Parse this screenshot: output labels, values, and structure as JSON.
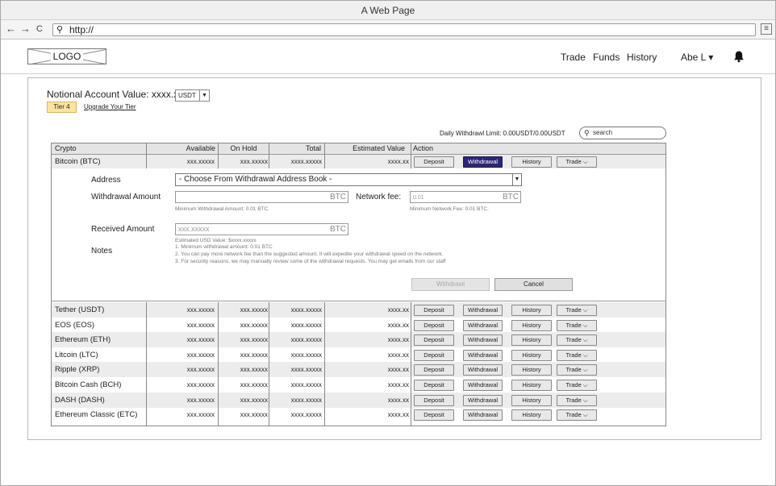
{
  "browser": {
    "title": "A Web Page",
    "url": "http://",
    "back_glyph": "←",
    "forward_glyph": "→",
    "reload_glyph": "C",
    "search_glyph": "⚲",
    "menu_glyph": "≡"
  },
  "header": {
    "logo": "LOGO",
    "nav": [
      "Trade",
      "Funds",
      "History"
    ],
    "user": "Abe L ▾",
    "bell_icon": "bell-icon"
  },
  "account": {
    "notional_label": "Notional Account Value: xxxx.xx",
    "currency": "USDT",
    "currency_arrow": "▼",
    "tier": "Tier 4",
    "upgrade_link": "Upgrade Your Tier",
    "daily_limit": "Daily Withdrawl Limit: 0.00USDT/0.00USDT",
    "search_placeholder": "search"
  },
  "table": {
    "headers": [
      "Crypto",
      "Available",
      "On Hold",
      "Total",
      "Estimated Value",
      "Action"
    ],
    "actions": {
      "deposit": "Deposit",
      "withdrawal": "Withdrawal",
      "history": "History",
      "trade": "Trade ⌵"
    },
    "selected_row": {
      "name": "Bitcoin (BTC)",
      "available": "xxx.xxxxx",
      "on_hold": "xxx.xxxxx",
      "total": "xxxx.xxxxx",
      "est": "xxxx.xx"
    },
    "rows": [
      {
        "name": "Tether (USDT)",
        "available": "xxx.xxxxx",
        "on_hold": "xxx.xxxxx",
        "total": "xxxx.xxxxx",
        "est": "xxxx.xx"
      },
      {
        "name": "EOS (EOS)",
        "available": "xxx.xxxxx",
        "on_hold": "xxx.xxxxx",
        "total": "xxxx.xxxxx",
        "est": "xxxx.xx"
      },
      {
        "name": "Ethereum (ETH)",
        "available": "xxx.xxxxx",
        "on_hold": "xxx.xxxxx",
        "total": "xxxx.xxxxx",
        "est": "xxxx.xx"
      },
      {
        "name": "Litcoin (LTC)",
        "available": "xxx.xxxxx",
        "on_hold": "xxx.xxxxx",
        "total": "xxxx.xxxxx",
        "est": "xxxx.xx"
      },
      {
        "name": "Ripple (XRP)",
        "available": "xxx.xxxxx",
        "on_hold": "xxx.xxxxx",
        "total": "xxxx.xxxxx",
        "est": "xxxx.xx"
      },
      {
        "name": "Bitcoin Cash (BCH)",
        "available": "xxx.xxxxx",
        "on_hold": "xxx.xxxxx",
        "total": "xxxx.xxxxx",
        "est": "xxxx.xx"
      },
      {
        "name": "DASH (DASH)",
        "available": "xxx.xxxxx",
        "on_hold": "xxx.xxxxx",
        "total": "xxxx.xxxxx",
        "est": "xxxx.xx"
      },
      {
        "name": "Ethereum Classic (ETC)",
        "available": "xxx.xxxxx",
        "on_hold": "xxx.xxxxx",
        "total": "xxxx.xxxxx",
        "est": "xxxx.xx"
      }
    ]
  },
  "withdrawal": {
    "address_label": "Address",
    "address_placeholder": "- Choose From Withdrawal Address Book -",
    "amount_label": "Withdrawal Amount",
    "amount_unit": "BTC",
    "amount_hint": "Minimum Withdrawal Amount: 0.01 BTC.",
    "fee_label": "Network fee:",
    "fee_value": "0.01",
    "fee_unit": "BTC",
    "fee_hint": "Minimum Network Fee: 0.01 BTC.",
    "received_label": "Received Amount",
    "received_placeholder": "xxx.xxxxx",
    "received_unit": "BTC",
    "usd_hint": "Estimated USD Value: $xxxx.xxxxx",
    "notes_label": "Notes",
    "notes": [
      "1. Minimum withdrawal amount: 0.01 BTC",
      "2. You can pay more network fee than the suggested amount. It will expedite your withdrawal speed on the network.",
      "3. For security reasons, we may manually review some of the withdrawal requests. You may get emails from our staff"
    ],
    "submit": "Withdrawl",
    "cancel": "Cancel"
  }
}
